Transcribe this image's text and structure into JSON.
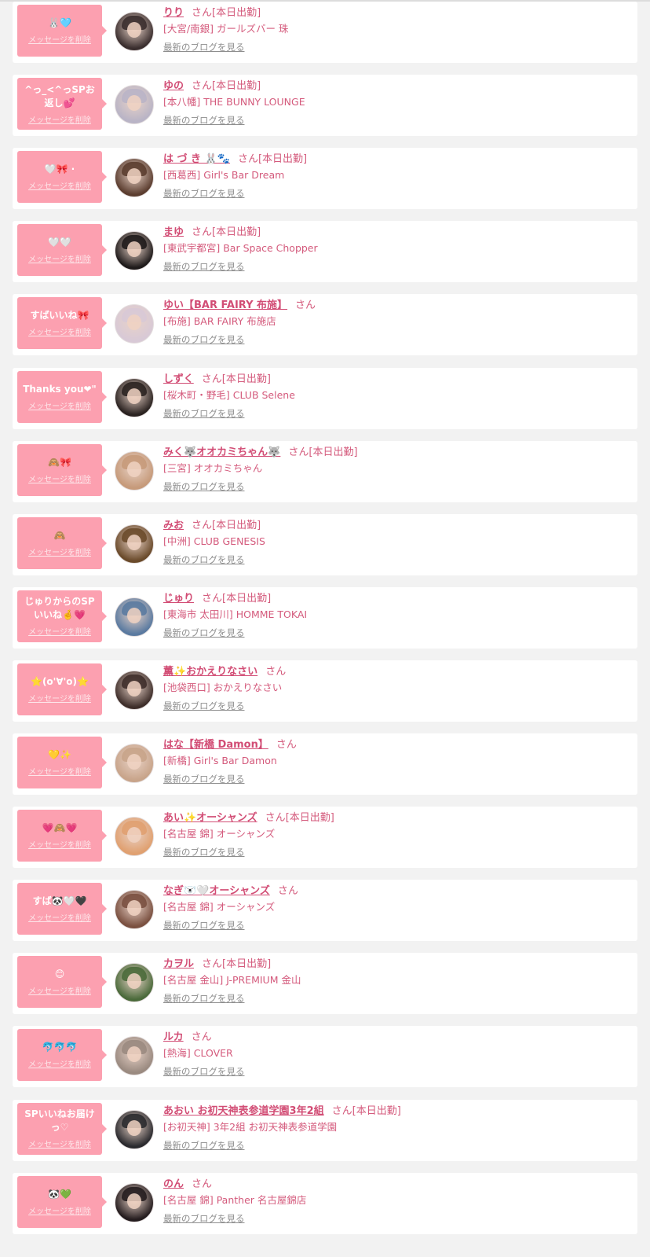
{
  "delete_label": "メッセージを削除",
  "blog_label": "最新のブログを見る",
  "san_label": "さん",
  "on_duty_label": "[本日出勤]",
  "colors": {
    "bubble": "#fca0b0",
    "accent": "#d24d75",
    "card": "#ffffff",
    "background": "#f2f2f2"
  },
  "items": [
    {
      "message": "🐰🩵",
      "name": "りり",
      "on_duty": true,
      "shop": "[大宮/南銀] ガールズバー 珠",
      "avatar_tone": "#3a2e2e"
    },
    {
      "message": "^っ_<^っSPお返し💕",
      "name": "ゆの",
      "on_duty": true,
      "shop": "[本八幡] THE BUNNY LOUNGE",
      "avatar_tone": "#b9b4c6"
    },
    {
      "message": "🤍🎀 ‧",
      "name": "は づ き 🐰🐾",
      "on_duty": true,
      "shop": "[西葛西] Girl's Bar Dream",
      "avatar_tone": "#5b3d2f"
    },
    {
      "message": "🤍🤍",
      "name": "まゆ",
      "on_duty": true,
      "shop": "[東武宇都宮] Bar Space Chopper",
      "avatar_tone": "#1e1a1a"
    },
    {
      "message": "すばいいね🎀",
      "name": "ゆい【BAR FAIRY 布施】",
      "on_duty": false,
      "shop": "[布施] BAR FAIRY 布施店",
      "avatar_tone": "#d8c9d6"
    },
    {
      "message": "Thanks you❤︎\"",
      "name": "しずく",
      "on_duty": true,
      "shop": "[桜木町・野毛] CLUB Selene",
      "avatar_tone": "#2a2220"
    },
    {
      "message": "🙈🎀",
      "name": "みく🐺オオカミちゃん🐺",
      "on_duty": true,
      "shop": "[三宮] オオカミちゃん",
      "avatar_tone": "#c69a7a"
    },
    {
      "message": "🙈",
      "name": "みお",
      "on_duty": true,
      "shop": "[中洲] CLUB GENESIS",
      "avatar_tone": "#6a4a2a"
    },
    {
      "message": "じゅりからのSPいいね🤞💗",
      "name": "じゅり",
      "on_duty": true,
      "shop": "[東海市 太田川] HOMME TOKAI",
      "avatar_tone": "#5a7aa0"
    },
    {
      "message": "⭐️(o'∀'o)⭐️",
      "name": "薫✨おかえりなさい",
      "on_duty": false,
      "shop": "[池袋西口] おかえりなさい",
      "avatar_tone": "#3e2e2a"
    },
    {
      "message": "💛✨",
      "name": "はな【新橋 Damon】",
      "on_duty": false,
      "shop": "[新橋] Girl's Bar Damon",
      "avatar_tone": "#c8a48a"
    },
    {
      "message": "💗🙈💗",
      "name": "あい✨オーシャンズ",
      "on_duty": true,
      "shop": "[名古屋 錦] オーシャンズ",
      "avatar_tone": "#e0a070"
    },
    {
      "message": "すば🐼🤍🖤",
      "name": "なぎ🐻‍❄️🤍オーシャンズ",
      "on_duty": false,
      "shop": "[名古屋 錦] オーシャンズ",
      "avatar_tone": "#7a5040"
    },
    {
      "message": "😊",
      "name": "カヲル",
      "on_duty": true,
      "shop": "[名古屋 金山] J-PREMIUM 金山",
      "avatar_tone": "#4a6a3a"
    },
    {
      "message": "🐬🐬🐬",
      "name": "ルカ",
      "on_duty": false,
      "shop": "[熱海] CLOVER",
      "avatar_tone": "#9a8a80"
    },
    {
      "message": "SPいいねお届けっ♡",
      "name": "あおい お初天神表参道学園3年2組",
      "on_duty": true,
      "shop": "[お初天神] 3年2組 お初天神表参道学園",
      "avatar_tone": "#2a2a2e"
    },
    {
      "message": "🐼💚",
      "name": "のん",
      "on_duty": false,
      "shop": "[名古屋 錦] Panther 名古屋錦店",
      "avatar_tone": "#241c1e"
    }
  ]
}
